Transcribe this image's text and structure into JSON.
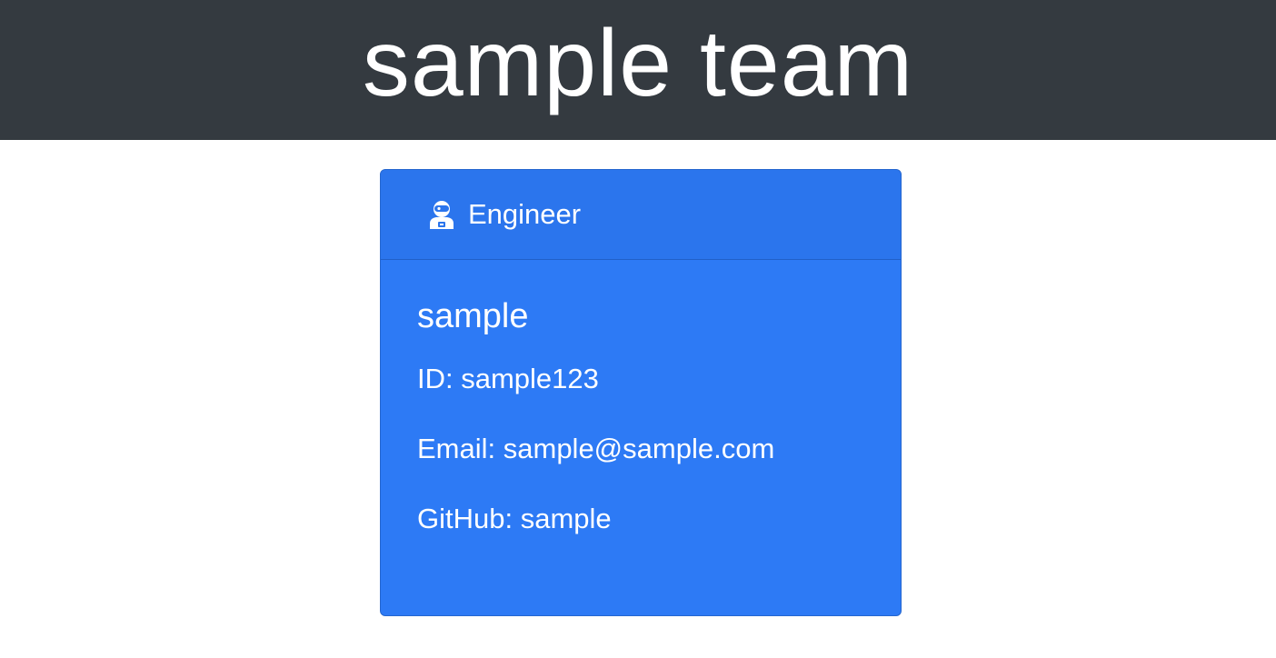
{
  "header": {
    "title": "sample team"
  },
  "card": {
    "role_icon": "engineer-icon",
    "role": "Engineer",
    "name": "sample",
    "id_line": "ID: sample123",
    "email_label": "Email: ",
    "email": "sample@sample.com",
    "github_label": "GitHub: ",
    "github": "sample"
  },
  "colors": {
    "header_bg": "#343a40",
    "card_bg": "#2d7af5",
    "card_header_bg": "#2b75ed",
    "text": "#ffffff"
  }
}
